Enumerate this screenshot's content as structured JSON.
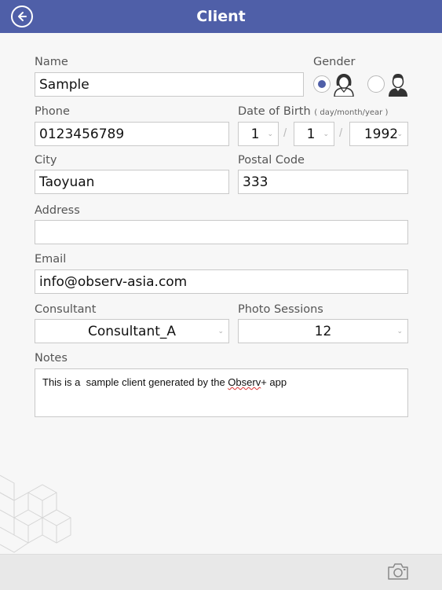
{
  "header": {
    "title": "Client",
    "back_icon": "back-arrow-icon"
  },
  "form": {
    "name_label": "Name",
    "name_value": "Sample",
    "gender_label": "Gender",
    "gender_selected": "female",
    "phone_label": "Phone",
    "phone_value": "0123456789",
    "dob_label": "Date of Birth",
    "dob_hint": "( day/month/year )",
    "dob_day": "1",
    "dob_month": "1",
    "dob_year": "1992",
    "dob_separator": "/",
    "city_label": "City",
    "city_value": "Taoyuan",
    "postal_label": "Postal Code",
    "postal_value": "333",
    "address_label": "Address",
    "address_value": "",
    "email_label": "Email",
    "email_value": "info@observ-asia.com",
    "consultant_label": "Consultant",
    "consultant_value": "Consultant_A",
    "sessions_label": "Photo Sessions",
    "sessions_value": "12",
    "notes_label": "Notes",
    "notes_before": "This is a  sample client generated by the ",
    "notes_misspelled": "Observ",
    "notes_after": "+ app"
  },
  "footer": {
    "camera_icon": "camera-icon"
  },
  "colors": {
    "header_bg": "#4f5fa8",
    "radio_selected": "#4f5fa8"
  }
}
